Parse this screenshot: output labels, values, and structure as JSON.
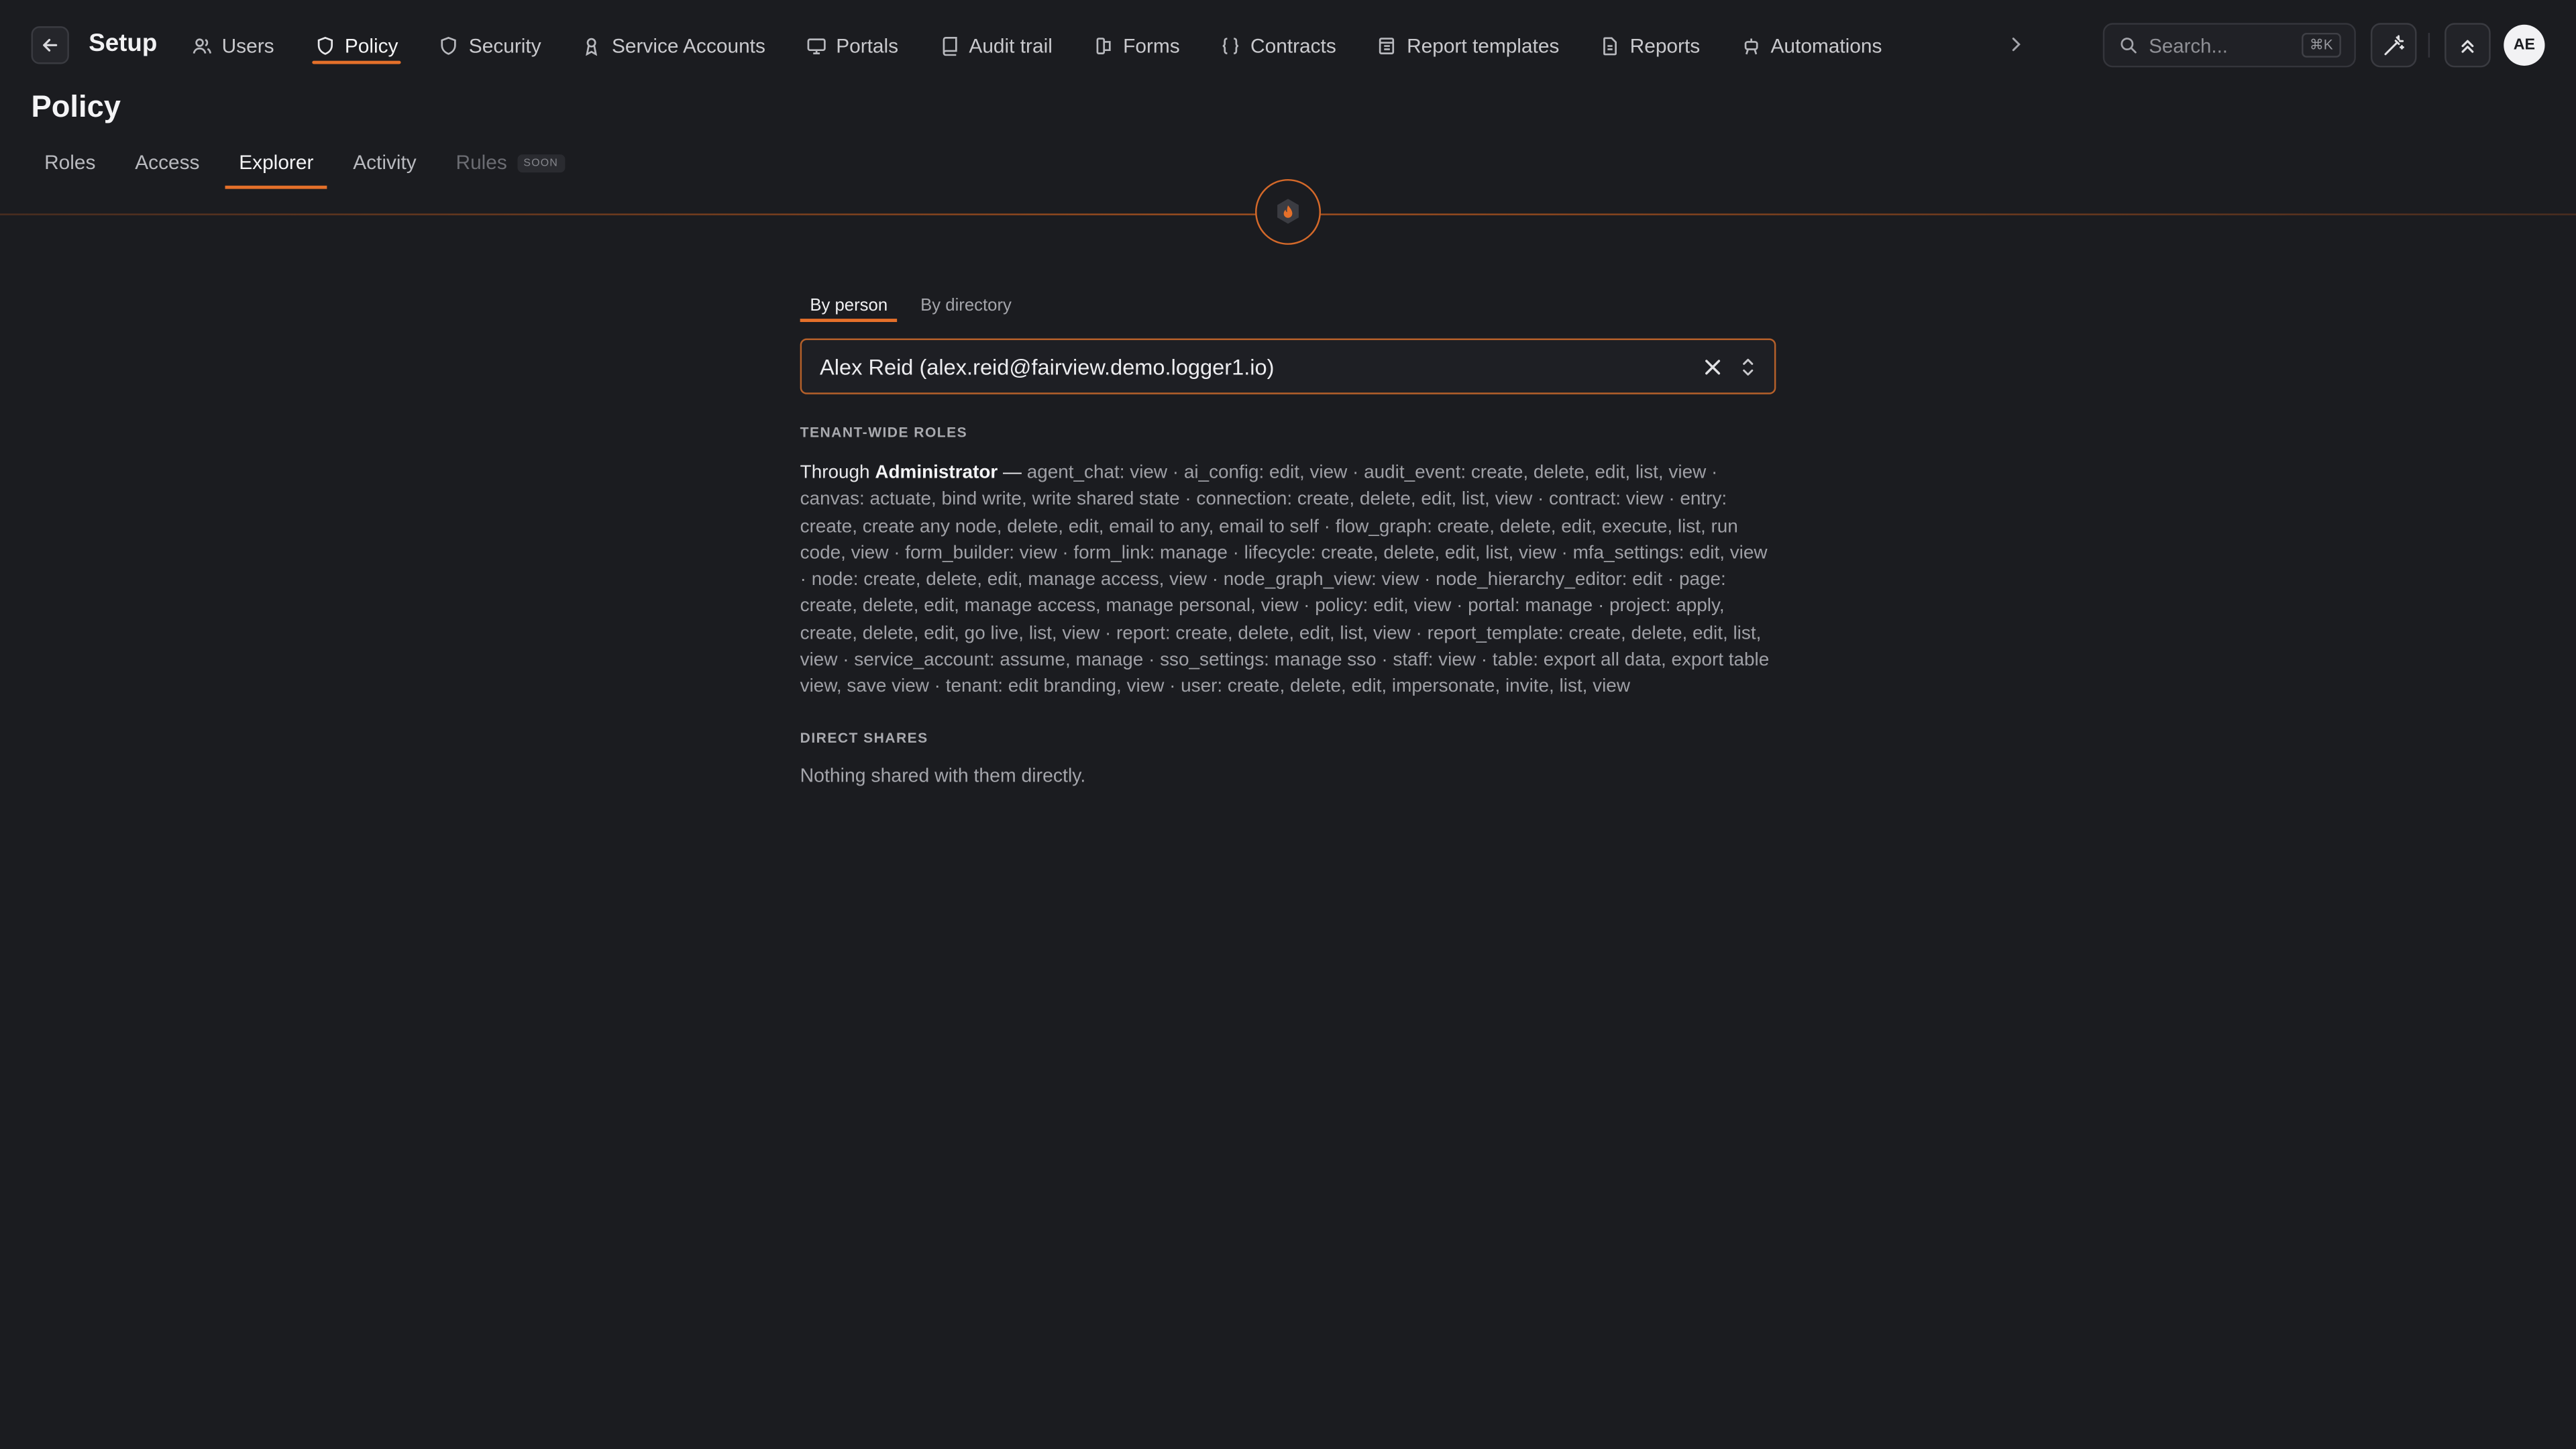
{
  "header": {
    "app_title": "Setup",
    "nav": [
      {
        "label": "Users",
        "icon": "users-icon"
      },
      {
        "label": "Policy",
        "icon": "shield-icon",
        "active": true
      },
      {
        "label": "Security",
        "icon": "shield-icon"
      },
      {
        "label": "Service Accounts",
        "icon": "service-account-icon"
      },
      {
        "label": "Portals",
        "icon": "monitor-icon"
      },
      {
        "label": "Audit trail",
        "icon": "book-icon"
      },
      {
        "label": "Forms",
        "icon": "form-icon"
      },
      {
        "label": "Contracts",
        "icon": "braces-icon"
      },
      {
        "label": "Report templates",
        "icon": "template-icon"
      },
      {
        "label": "Reports",
        "icon": "file-icon"
      },
      {
        "label": "Automations",
        "icon": "robot-icon"
      }
    ],
    "search_placeholder": "Search...",
    "search_shortcut": "⌘K",
    "avatar_initials": "AE"
  },
  "page": {
    "title": "Policy",
    "tabs": [
      {
        "label": "Roles"
      },
      {
        "label": "Access"
      },
      {
        "label": "Explorer",
        "active": true
      },
      {
        "label": "Activity"
      },
      {
        "label": "Rules",
        "disabled": true,
        "badge": "SOON"
      }
    ]
  },
  "explorer": {
    "mode_tabs": [
      {
        "label": "By person",
        "active": true
      },
      {
        "label": "By directory"
      }
    ],
    "selected_person": "Alex Reid (alex.reid@fairview.demo.logger1.io)",
    "tenant_roles_label": "TENANT-WIDE ROLES",
    "roles_prefix": "Through",
    "role_name": "Administrator",
    "roles_separator": "—",
    "permissions": "agent_chat: view · ai_config: edit, view · audit_event: create, delete, edit, list, view · canvas: actuate, bind write, write shared state · connection: create, delete, edit, list, view · contract: view · entry: create, create any node, delete, edit, email to any, email to self · flow_graph: create, delete, edit, execute, list, run code, view · form_builder: view · form_link: manage · lifecycle: create, delete, edit, list, view · mfa_settings: edit, view · node: create, delete, edit, manage access, view · node_graph_view: view · node_hierarchy_editor: edit · page: create, delete, edit, manage access, manage personal, view · policy: edit, view · portal: manage · project: apply, create, delete, edit, go live, list, view · report: create, delete, edit, list, view · report_template: create, delete, edit, list, view · service_account: assume, manage · sso_settings: manage sso · staff: view · table: export all data, export table view, save view · tenant: edit branding, view · user: create, delete, edit, impersonate, invite, list, view",
    "direct_shares_label": "DIRECT SHARES",
    "direct_shares_empty": "Nothing shared with them directly."
  },
  "colors": {
    "background": "#1b1c20",
    "accent": "#e5702a"
  }
}
